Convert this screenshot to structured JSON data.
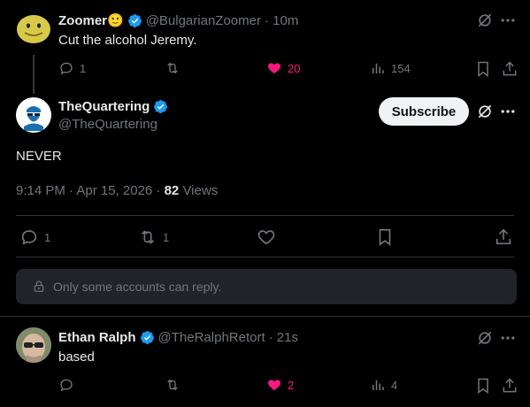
{
  "tweets": [
    {
      "name": "Zoomer🙂",
      "handle": "@BulgarianZoomer",
      "time": "· 10m",
      "text": "Cut the alcohol Jeremy.",
      "replies": "1",
      "likes": "20",
      "views": "154"
    },
    {
      "name": "Ethan Ralph",
      "handle": "@TheRalphRetort",
      "time": "· 21s",
      "text": "based",
      "likes": "2",
      "views": "4"
    }
  ],
  "main": {
    "name": "TheQuartering",
    "handle": "@TheQuartering",
    "subscribe_label": "Subscribe",
    "text": "NEVER",
    "datetime": "9:14 PM · Apr 15, 2026 · ",
    "views_count": "82",
    "views_label": " Views",
    "replies": "1",
    "reposts": "1",
    "reply_notice": "Only some accounts can reply."
  },
  "colors": {
    "verified": "#1d9bf0",
    "like": "#f91880",
    "muted": "#71767b"
  }
}
